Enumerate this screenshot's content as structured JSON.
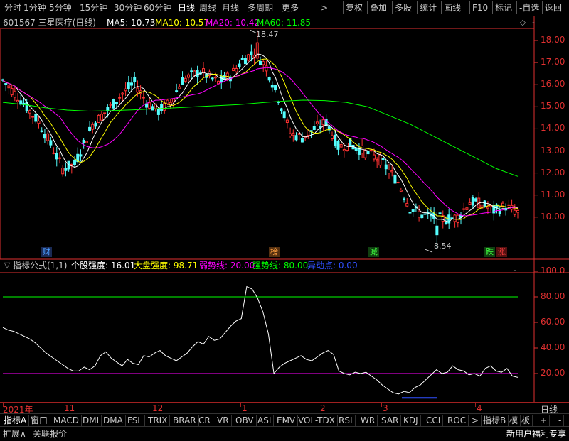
{
  "toolbar": {
    "left_items": [
      "分时",
      "1分钟",
      "5分钟",
      "15分钟",
      "30分钟",
      "60分钟",
      "日线",
      "周线",
      "月线",
      "多周期",
      "更多"
    ],
    "active": "日线",
    "more_arrow": ">",
    "right_items": [
      "复权",
      "叠加",
      "多股",
      "统计",
      "画线",
      "F10",
      "标记",
      "-自选",
      "返回"
    ]
  },
  "info": {
    "code_name": "601567 三星医疗(日线)",
    "ma5": "MA5: 10.73",
    "ma10": "MA10: 10.57",
    "ma20": "MA20: 10.42",
    "ma60": "MA60: 11.85"
  },
  "colors": {
    "up": "#ff3232",
    "down": "#54fcfc",
    "ma5": "#ffffff",
    "ma10": "#ffff00",
    "ma20": "#ff00ff",
    "ma60": "#00ff00",
    "axis": "#e03030"
  },
  "price_axis": {
    "labels": [
      "18.00",
      "17.00",
      "16.00",
      "15.00",
      "14.00",
      "13.00",
      "12.00",
      "11.00",
      "10.00"
    ],
    "high_label": "18.47",
    "low_label": "8.54"
  },
  "event_markers": [
    {
      "text": "财",
      "color": "#4a9cff",
      "bg": "#1a2a55"
    },
    {
      "text": "榜",
      "color": "#ffa040",
      "bg": "#553010"
    },
    {
      "text": "减",
      "color": "#40ff40",
      "bg": "#104010"
    },
    {
      "text": "跌",
      "color": "#40ff40",
      "bg": "#104010"
    },
    {
      "text": "涨",
      "color": "#ff4040",
      "bg": "#551010"
    }
  ],
  "indicator": {
    "name": "指标公式(1,1)",
    "stock_strength": "个股强度: 16.01",
    "market_strength": "大盘强度: 98.71",
    "weak_line": "弱势线: 20.00",
    "strong_line": "强势线: 80.00",
    "anomaly": "异动点: 0.00",
    "axis_labels": [
      "100.0",
      "80.00",
      "60.00",
      "40.00",
      "20.00"
    ],
    "dash_mark": "-"
  },
  "chart_data": {
    "type": "line",
    "title": "601567 三星医疗(日线)",
    "price_range": [
      8.3,
      18.6
    ],
    "ma60_trend": [
      15.2,
      15.1,
      14.95,
      14.85,
      14.8,
      14.82,
      14.86,
      14.9,
      14.95,
      15.0,
      15.05,
      15.1,
      15.18,
      15.25,
      15.3,
      15.28,
      15.2,
      15.0,
      14.6,
      14.2,
      13.7,
      13.2,
      12.7,
      12.2,
      11.85
    ],
    "oscillator_range": [
      0,
      110
    ],
    "oscillator": [
      56,
      54,
      53,
      51,
      49,
      47,
      44,
      40,
      36,
      33,
      30,
      27,
      24,
      22,
      22,
      25,
      23,
      26,
      34,
      37,
      32,
      29,
      26,
      31,
      28,
      27,
      34,
      33,
      36,
      38,
      34,
      32,
      30,
      33,
      36,
      41,
      45,
      43,
      49,
      46,
      47,
      52,
      57,
      61,
      63,
      88,
      86,
      79,
      68,
      51,
      20,
      25,
      28,
      30,
      32,
      34,
      31,
      30,
      33,
      36,
      38,
      35,
      22,
      20,
      19,
      21,
      20,
      21,
      18,
      15,
      11,
      8,
      5,
      4,
      6,
      5,
      9,
      11,
      15,
      19,
      23,
      20,
      21,
      26,
      23,
      22,
      19,
      20,
      18,
      24,
      26,
      22,
      21,
      24,
      18,
      17
    ],
    "weak_line": 20,
    "strong_line": 80,
    "date_ticks": [
      "2021年",
      "11",
      "12",
      "1",
      "2",
      "3",
      "4"
    ]
  },
  "date_bar": {
    "period": "日线"
  },
  "tabs": {
    "items": [
      "指标A",
      "窗口",
      "MACD",
      "DMI",
      "DMA",
      "FSL",
      "TRIX",
      "BRAR",
      "CR",
      "VR",
      "OBV",
      "ASI",
      "EMV",
      "VOL-TDX",
      "RSI",
      "WR",
      "SAR",
      "KDJ",
      "CCI",
      "ROC"
    ],
    "more_arrow": ">",
    "right_items": [
      "指标B",
      "模",
      "板",
      "+",
      "-"
    ]
  },
  "status": {
    "expand": "扩展∧",
    "quote": "关联报价",
    "promo": "新用户福利专享"
  }
}
